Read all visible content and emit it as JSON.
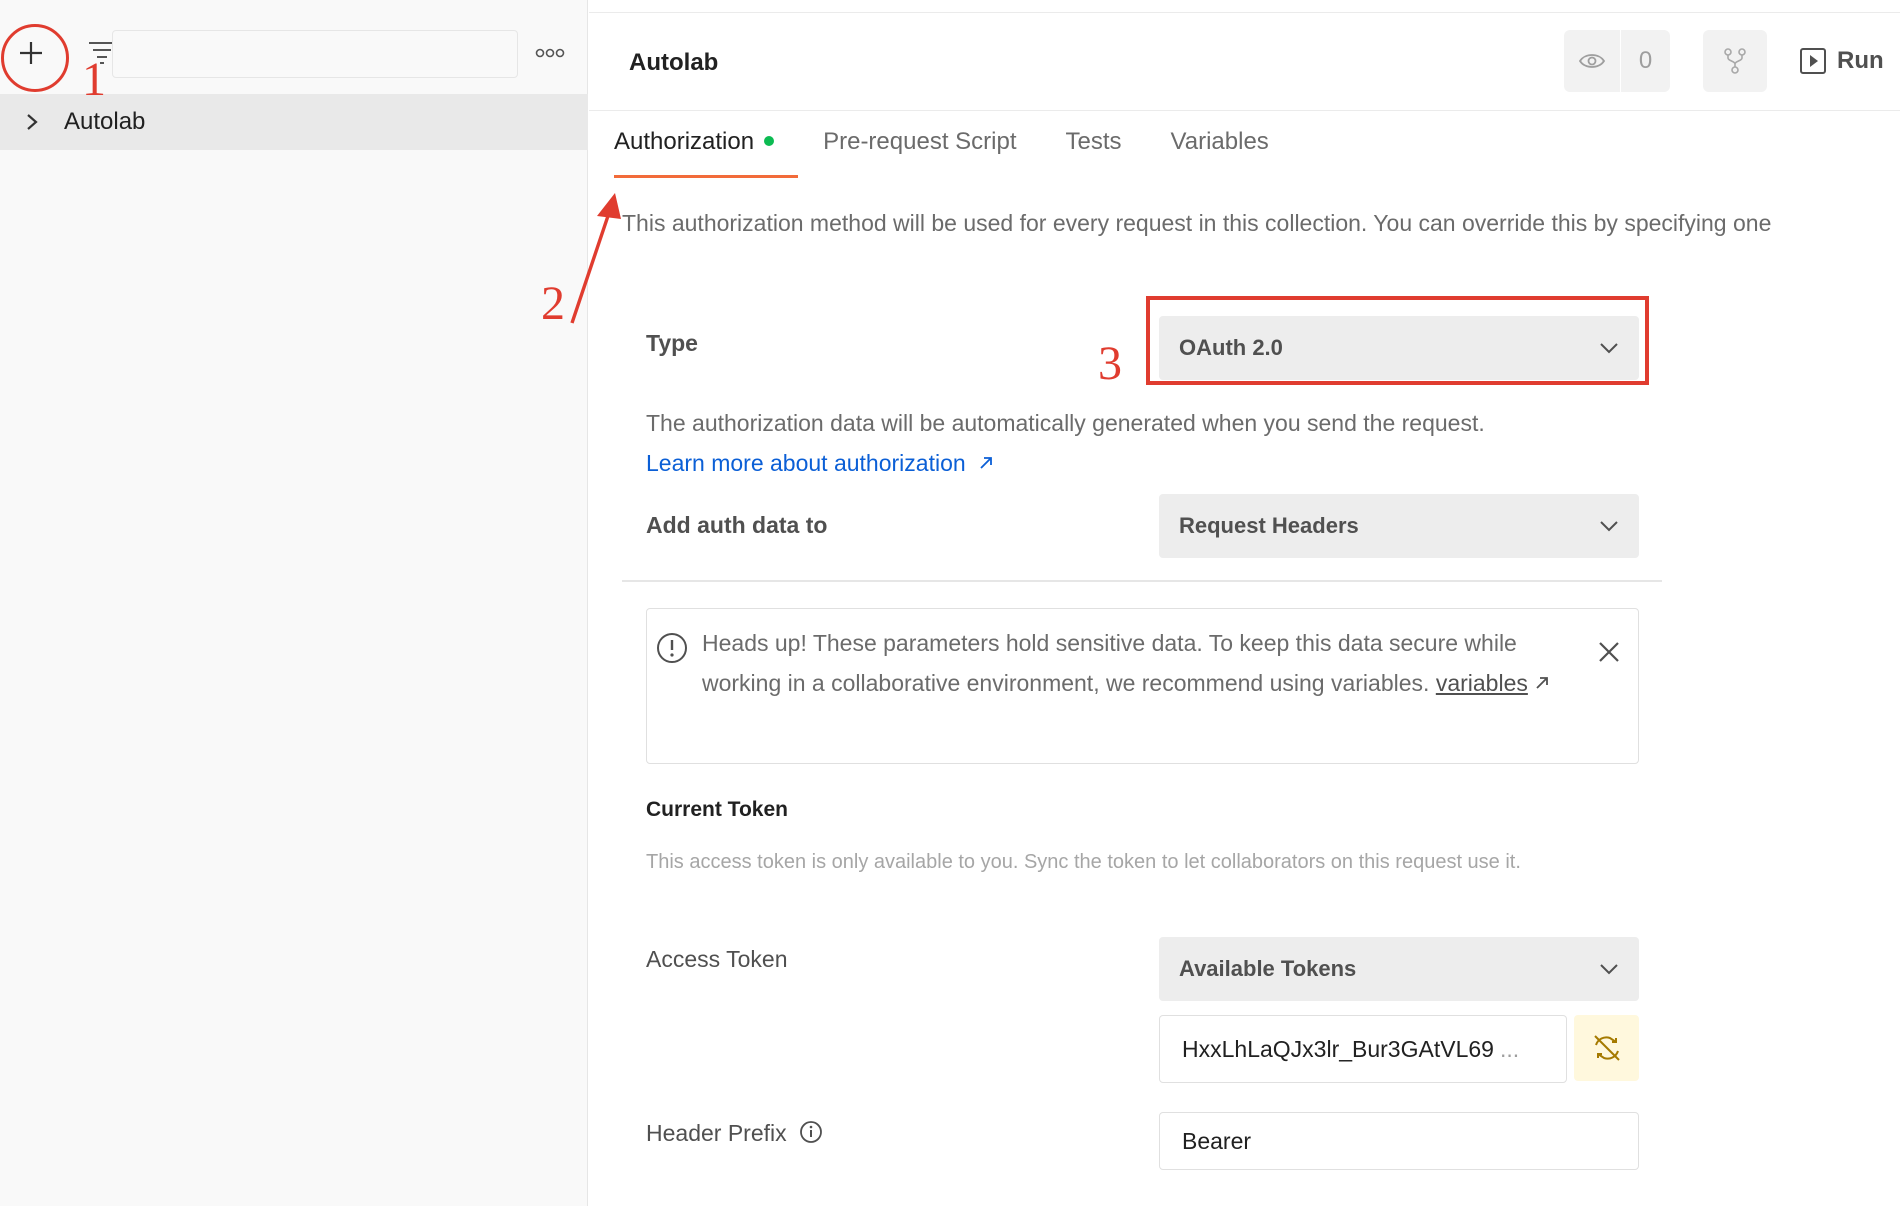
{
  "sidebar": {
    "search_placeholder": "",
    "collection_name": "Autolab"
  },
  "header": {
    "title": "Autolab",
    "watch_count": "0",
    "run_label": "Run"
  },
  "tabs": [
    {
      "label": "Authorization"
    },
    {
      "label": "Pre-request Script"
    },
    {
      "label": "Tests"
    },
    {
      "label": "Variables"
    }
  ],
  "auth": {
    "intro": "This authorization method will be used for every request in this collection. You can override this by specifying one",
    "type_label": "Type",
    "type_value": "OAuth 2.0",
    "note": "The authorization data will be automatically generated when you send the request.",
    "learn_more": "Learn more about authorization",
    "add_to_label": "Add auth data to",
    "add_to_value": "Request Headers"
  },
  "alert": {
    "text": "Heads up! These parameters hold sensitive data. To keep this data secure while working in a collaborative environment, we recommend using variables.",
    "link": "variables"
  },
  "current_token": {
    "title": "Current Token",
    "note": "This access token is only available to you. Sync the token to let collaborators on this request use it.",
    "access_token_label": "Access Token",
    "available_tokens": "Available Tokens",
    "token_value": "HxxLhLaQJx3lr_Bur3GAtVL69",
    "token_ellipsis": "...",
    "header_prefix_label": "Header Prefix",
    "header_prefix_value": "Bearer"
  },
  "annotations": {
    "n1": "1",
    "n2": "2",
    "n3": "3",
    "color": "#e03c2f"
  },
  "colors": {
    "accent": "#f26b3a",
    "link": "#0b5fd6",
    "status_dot": "#0cbb52"
  }
}
